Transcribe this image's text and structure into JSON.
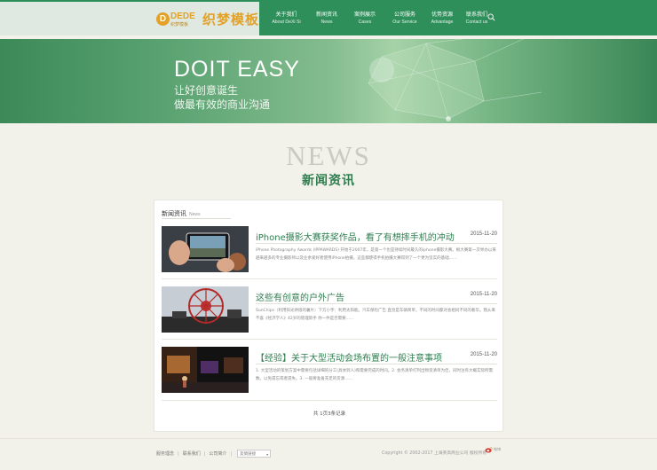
{
  "header": {
    "logo_mark": "D",
    "logo_text": "DEDE",
    "logo_sub": "织梦模板",
    "logo_cn": "织梦模板",
    "nav": [
      {
        "cn": "关于我们",
        "en": "About DeXi Si"
      },
      {
        "cn": "新闻资讯",
        "en": "News"
      },
      {
        "cn": "案例展示",
        "en": "Cases"
      },
      {
        "cn": "公司服务",
        "en": "Our Service"
      },
      {
        "cn": "优势资源",
        "en": "Advantage"
      },
      {
        "cn": "联系我们",
        "en": "Contact us"
      }
    ]
  },
  "banner": {
    "title": "DOIT EASY",
    "line1": "让好创意诞生",
    "line2": "做最有效的商业沟通"
  },
  "section": {
    "en": "NEWS",
    "cn": "新闻资讯"
  },
  "panel": {
    "head_cn": "新闻资讯",
    "head_en": "News",
    "items": [
      {
        "title": "iPhone摄影大赛获奖作品，看了有想摔手机的冲动",
        "date": "2015-11-20",
        "desc": "iPhone Photography Awards (IPPAWARDS) 开始于2007年，是第一个也是持续时间最久的iphone摄影大赛。根大赛第一次举办以来越来越多的专业摄影师以及业余爱好者使用iPhone拍摄，这些都使得手机拍摄大赛得到了一个更为坚实的基础……"
      },
      {
        "title": "这些有创意的户外广告",
        "date": "2015-11-20",
        "desc": "SunChips（利用阳光烘焙的薯片）下方小字：利用太阳能。汽车保险广告 直觉是车辆简单，不同的时间都对会相同不同的奢华。我从来不喜《经济学人》42岁的管理新手 你一件是否需要……"
      },
      {
        "title": "【经验】关于大型活动会场布置的一般注意事项",
        "date": "2015-11-20",
        "desc": "1. 大型活动的策划方案中需要包括详细的分工(具体到人)和需要完成的时间。2. 会务清单打列出物资清单为佳，同时注有大概实际所需数。以免遗忘或者遗失。3. 一般要准备充足的货源……"
      }
    ],
    "pager": "共 1页3条记录"
  },
  "footer": {
    "links": [
      "服务理念",
      "联系我们",
      "公司简介"
    ],
    "select_label": "友情链接",
    "copyright": "Copyright © 2002-2017 上海英高商业公司 版权所有",
    "weibo": "微博"
  }
}
